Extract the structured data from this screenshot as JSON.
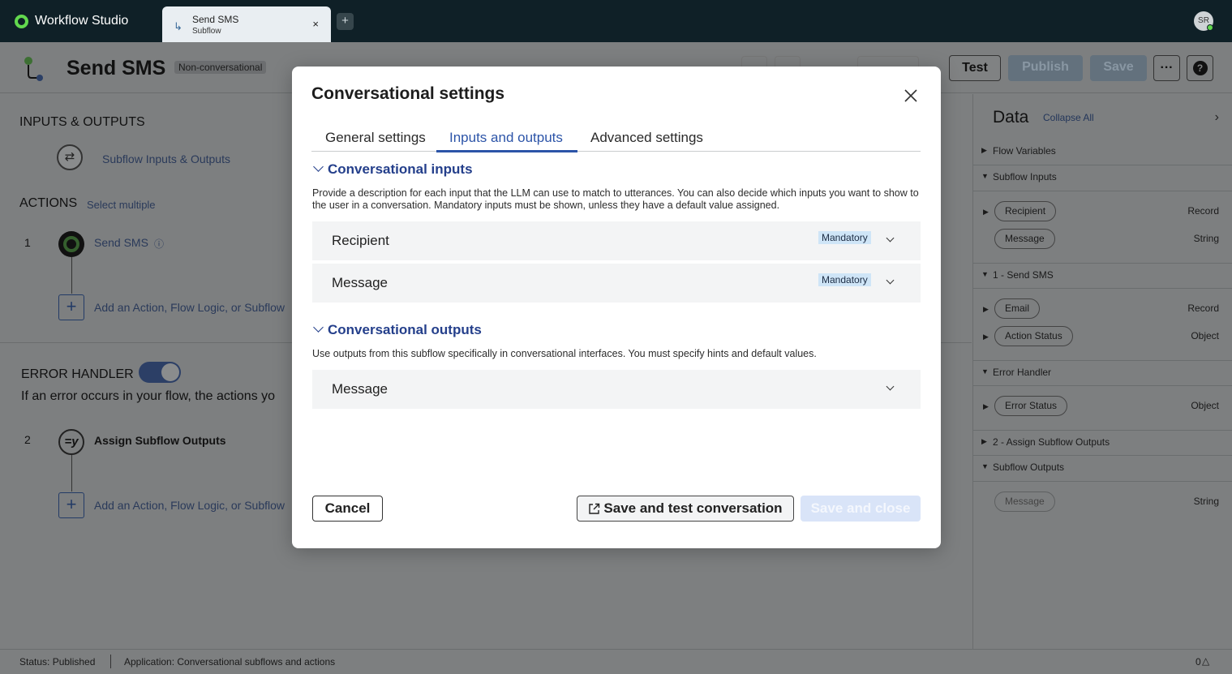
{
  "app": {
    "name": "Workflow Studio",
    "user_initials": "SR"
  },
  "tab": {
    "title": "Send SMS",
    "subtitle": "Subflow",
    "close": "×",
    "add": "+"
  },
  "flow": {
    "title": "Send SMS",
    "badge": "Non-conversational",
    "buttons": {
      "test": "Test",
      "publish": "Publish",
      "save": "Save",
      "more": "···",
      "help": "?"
    }
  },
  "left": {
    "inputs_outputs_title": "INPUTS & OUTPUTS",
    "io_link": "Subflow Inputs & Outputs",
    "actions_title": "ACTIONS",
    "select_multiple": "Select multiple",
    "step1": {
      "num": "1",
      "name": "Send SMS"
    },
    "add_action": "Add an Action, Flow Logic, or Subflow",
    "error_handler_title": "ERROR HANDLER",
    "error_desc": "If an error occurs in your flow, the actions yo",
    "step2": {
      "num": "2",
      "name": "Assign Subflow Outputs",
      "icon": "=y"
    }
  },
  "data_panel": {
    "title": "Data",
    "collapse_all": "Collapse All",
    "sections": {
      "flow_variables": "Flow Variables",
      "subflow_inputs": "Subflow Inputs",
      "send_sms": "1 - Send SMS",
      "error_handler": "Error Handler",
      "assign": "2 - Assign Subflow Outputs",
      "subflow_outputs": "Subflow Outputs"
    },
    "pills": {
      "recipient": {
        "label": "Recipient",
        "type": "Record"
      },
      "message_in": {
        "label": "Message",
        "type": "String"
      },
      "email": {
        "label": "Email",
        "type": "Record"
      },
      "action_status": {
        "label": "Action Status",
        "type": "Object"
      },
      "error_status": {
        "label": "Error Status",
        "type": "Object"
      },
      "message_out": {
        "label": "Message",
        "type": "String"
      }
    }
  },
  "status_bar": {
    "status": "Status: Published",
    "application": "Application: Conversational subflows and actions",
    "count": "0"
  },
  "modal": {
    "title": "Conversational settings",
    "tabs": [
      "General settings",
      "Inputs and outputs",
      "Advanced settings"
    ],
    "active_tab": "Inputs and outputs",
    "inputs": {
      "heading": "Conversational inputs",
      "description": "Provide a description for each input that the LLM can use to match to utterances. You can also decide which inputs you want to show to the user in a conversation. Mandatory inputs must be shown, unless they have a default value assigned.",
      "items": [
        {
          "label": "Recipient",
          "badge": "Mandatory"
        },
        {
          "label": "Message",
          "badge": "Mandatory"
        }
      ]
    },
    "outputs": {
      "heading": "Conversational outputs",
      "description": "Use outputs from this subflow specifically in conversational interfaces. You must specify hints and default values.",
      "items": [
        {
          "label": "Message"
        }
      ]
    },
    "buttons": {
      "cancel": "Cancel",
      "save_test": "Save and test conversation",
      "save_close": "Save and close"
    }
  },
  "colors": {
    "accent": "#2c54a8",
    "heading": "#243f8b",
    "topbar": "#0f2027",
    "badge_bg": "#cfe5f7"
  }
}
